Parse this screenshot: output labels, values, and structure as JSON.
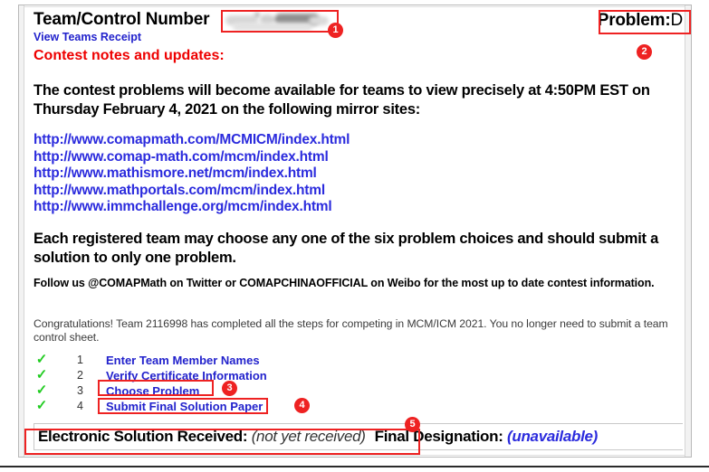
{
  "header": {
    "team_label": "Team/Control Number",
    "team_number_redacted": "",
    "view_receipt_link": "View Teams Receipt",
    "problem_label": "Problem:",
    "problem_value": "D"
  },
  "notes": {
    "title": "Contest notes and updates:",
    "availability_paragraph": "The contest problems will become available for teams to view precisely at 4:50PM EST on Thursday February 4, 2021 on the following mirror sites:",
    "mirror_sites": [
      "http://www.comapmath.com/MCMICM/index.html",
      "http://www.comap-math.com/mcm/index.html",
      "http://www.mathismore.net/mcm/index.html",
      "http://www.mathportals.com/mcm/index.html",
      "http://www.immchallenge.org/mcm/index.html"
    ],
    "choice_paragraph": "Each registered team may choose any one of the six problem choices and should submit a solution to only one problem.",
    "follow_paragraph": "Follow us @COMAPMath on Twitter or COMAPCHINAOFFICIAL on Weibo for the most up to date contest information.",
    "congrats_paragraph": "Congratulations! Team 2116998 has completed all the steps for competing in MCM/ICM 2021. You no longer need to submit a team control sheet."
  },
  "checklist": {
    "check_glyph": "✓",
    "items": [
      {
        "number": "1",
        "label": "Enter Team Member Names"
      },
      {
        "number": "2",
        "label": "Verify Certificate Information"
      },
      {
        "number": "3",
        "label": "Choose Problem"
      },
      {
        "number": "4",
        "label": "Submit Final Solution Paper"
      }
    ]
  },
  "status": {
    "electronic_label": "Electronic Solution Received:",
    "electronic_value": "(not yet received)",
    "designation_label": "Final Designation:",
    "designation_value": "(unavailable)"
  },
  "annotations": {
    "badges": [
      {
        "id": "1",
        "text": "1"
      },
      {
        "id": "2",
        "text": "2"
      },
      {
        "id": "3",
        "text": "3"
      },
      {
        "id": "4",
        "text": "4"
      },
      {
        "id": "5",
        "text": "5"
      }
    ]
  },
  "colors": {
    "annotation_red": "#ee2222",
    "link_blue": "#2222cc",
    "notes_red": "#ee0000",
    "check_green": "#22cc22"
  }
}
